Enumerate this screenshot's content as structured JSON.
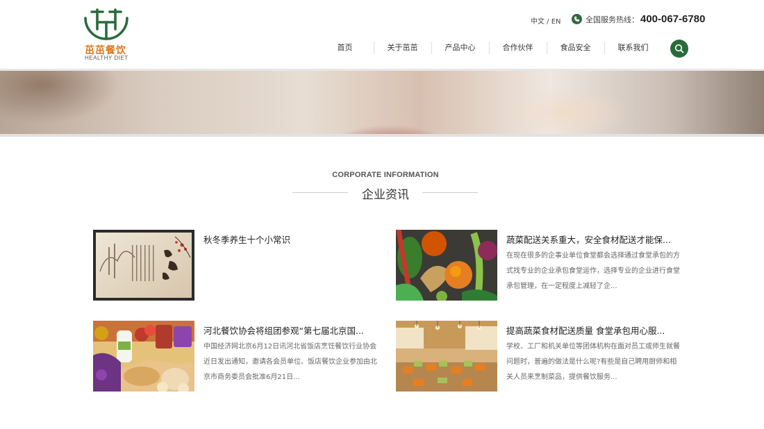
{
  "header": {
    "logo_cn": "茁茁餐饮",
    "logo_en": "HEALTHY DIET",
    "lang": "中文 / EN",
    "hotline_label": "全国服务热线：",
    "hotline_number": "400-067-6780",
    "brand_color": "#2a6b3b",
    "accent_color": "#d9771d"
  },
  "nav": {
    "items": [
      {
        "label": "首页"
      },
      {
        "label": "关于茁茁"
      },
      {
        "label": "产品中心"
      },
      {
        "label": "合作伙伴"
      },
      {
        "label": "食品安全"
      },
      {
        "label": "联系我们"
      }
    ]
  },
  "section": {
    "title_en": "CORPORATE INFORMATION",
    "title_cn": "企业资讯"
  },
  "news": [
    {
      "title": "秋冬季养生十个小常识",
      "desc": "",
      "image": "calligraphy-painting"
    },
    {
      "title": "蔬菜配送关系重大，安全食材配送才能保...",
      "desc": "在现在很多的企事业单位食堂都会选择通过食堂承包的方式找专业的企业承包食堂运作，选择专业的企业进行食堂承包管理，在一定程度上减轻了企...",
      "image": "vegetables"
    },
    {
      "title": "河北餐饮协会将组团参观“第七届北京国...",
      "desc": "中国经济网北京6月12日讯河北省饭店烹饪餐饮行业协会近日发出通知，邀请各会员单位、饭店餐饮企业参加由北京市商务委员会批准6月21日...",
      "image": "groceries"
    },
    {
      "title": "提高蔬菜食材配送质量 食堂承包用心服...",
      "desc": "学校、工厂和机关单位等团体机构在面对员工或师生就餐问题时，普遍的做法是什么呢?有些是自己聘用厨师和相关人员来烹制菜品，提供餐饮服务...",
      "image": "restaurant-interior"
    }
  ]
}
